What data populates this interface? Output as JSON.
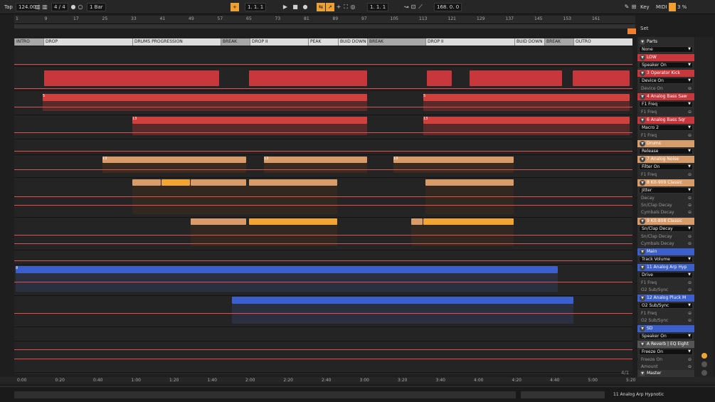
{
  "transport": {
    "tap": "Tap",
    "tempo": "124.00",
    "signature": "4 / 4",
    "quantize": "1 Bar",
    "position": "1. 1. 1",
    "loop_start": "1. 1. 1",
    "loop_length": "168. 0. 0",
    "key": "Key",
    "midi": "MIDI",
    "cpu": "3 %"
  },
  "ruler": {
    "bars": [
      "1",
      "9",
      "17",
      "25",
      "33",
      "41",
      "49",
      "57",
      "65",
      "73",
      "81",
      "89",
      "97",
      "105",
      "113",
      "121",
      "129",
      "137",
      "145",
      "153",
      "161"
    ]
  },
  "locators": [
    {
      "label": "INTRO",
      "gray": true
    },
    {
      "label": "DROP",
      "gray": false
    },
    {
      "label": "DRUMS PROGRESSION",
      "gray": false
    },
    {
      "label": "BREAK",
      "gray": true
    },
    {
      "label": "DROP II",
      "gray": false
    },
    {
      "label": "PEAK",
      "gray": false
    },
    {
      "label": "BUID DOWN",
      "gray": false
    },
    {
      "label": "BREAK",
      "gray": true
    },
    {
      "label": "DROP II",
      "gray": false
    },
    {
      "label": "BUID DOWN",
      "gray": false
    },
    {
      "label": "BREAK",
      "gray": true
    },
    {
      "label": "OUTRO",
      "gray": false
    }
  ],
  "clip_labels": [
    "5",
    "13",
    "5",
    "13",
    "13",
    "13",
    "13",
    "8"
  ],
  "timeline": [
    "0:00",
    "0:20",
    "0:40",
    "1:00",
    "1:20",
    "1:40",
    "2:00",
    "2:20",
    "2:40",
    "3:00",
    "3:20",
    "3:40",
    "4:00",
    "4:20",
    "4:40",
    "5:00",
    "5:20"
  ],
  "right_panel": {
    "set_label": "Set",
    "tracks": [
      {
        "name": "Parts",
        "dropdown": "None",
        "params": []
      },
      {
        "name": "LOW",
        "dropdown": "Speaker On",
        "params": []
      },
      {
        "name": "3 Operator Kick",
        "dropdown": "Device On",
        "params": [
          "Device On"
        ]
      },
      {
        "name": "4 Analog Bass Saw",
        "dropdown": "F1 Freq",
        "params": [
          "F1 Freq"
        ]
      },
      {
        "name": "6 Analog Bass Sqr",
        "dropdown": "Macro 2",
        "params": [
          "F1 Freq"
        ]
      },
      {
        "name": "Drums",
        "dropdown": "Release",
        "params": []
      },
      {
        "name": "7 Analog Noise",
        "dropdown": "Filter On",
        "params": [
          "F1 Freq"
        ]
      },
      {
        "name": "8 Kit-909 Classic",
        "dropdown": "Jitter",
        "params": [
          "Decay",
          "Sn/Clap Decay",
          "Cymbals Decay"
        ]
      },
      {
        "name": "9 Kit-808 Classic",
        "dropdown": "Sn/Clap Decay",
        "params": [
          "Sn/Clap Decay",
          "Cymbals Decay"
        ]
      },
      {
        "name": "Main",
        "dropdown": "Track Volume",
        "params": []
      },
      {
        "name": "11 Analog Arp Hyp",
        "dropdown": "Drive",
        "params": [
          "F1 Freq",
          "O2 Sub/Sync"
        ]
      },
      {
        "name": "12 Analog Pluck M",
        "dropdown": "O2 Sub/Sync",
        "params": [
          "F1 Freq",
          "O2 Sub/Sync"
        ]
      },
      {
        "name": "SD",
        "dropdown": "Speaker On",
        "params": []
      },
      {
        "name": "A Reverb | EQ Eight",
        "dropdown": "Freeze On",
        "params": [
          "Freeze On",
          "Amount"
        ]
      },
      {
        "name": "Master",
        "dropdown": "",
        "params": []
      }
    ]
  },
  "status": {
    "selected_track": "11 Analog Arp Hypnotic",
    "counter": "4/1"
  },
  "colors": {
    "red": "#c8373c",
    "orange": "#d89b6a",
    "amber": "#f2a533",
    "blue": "#3b5fcc",
    "envelope": "#e05050"
  }
}
